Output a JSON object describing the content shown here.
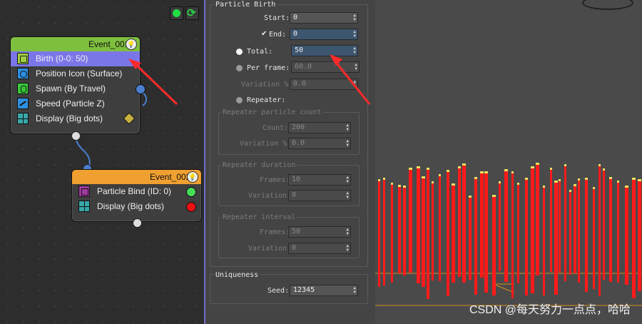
{
  "graph": {
    "toolbar": {
      "enable_icon": "green-circle-icon",
      "refresh_icon": "refresh-icon"
    },
    "event1": {
      "title": "Event_001",
      "color": "#7fbf3f",
      "operators": [
        {
          "label": "Birth (0-0: 50)",
          "icon": "birth-icon",
          "selected": true
        },
        {
          "label": "Position Icon (Surface)",
          "icon": "position-icon-icon"
        },
        {
          "label": "Spawn (By Travel)",
          "icon": "spawn-icon"
        },
        {
          "label": "Speed (Particle Z)",
          "icon": "speed-icon"
        },
        {
          "label": "Display (Big dots)",
          "icon": "display-icon"
        }
      ]
    },
    "event2": {
      "title": "Event_002",
      "color": "#f0a030",
      "operators": [
        {
          "label": "Particle Bind (ID: 0)",
          "icon": "particle-bind-icon"
        },
        {
          "label": "Display (Big dots)",
          "icon": "display-icon"
        }
      ]
    }
  },
  "panel": {
    "section_title": "Particle Birth",
    "start": {
      "label": "Start:",
      "value": "0"
    },
    "end": {
      "label": "End:",
      "value": "0",
      "checked": true
    },
    "total": {
      "label": "Total:",
      "value": "50"
    },
    "per_frame": {
      "label": "Per frame:",
      "value": "60.0"
    },
    "variation1": {
      "label": "Variation %:",
      "value": "0.0"
    },
    "repeater": {
      "label": "Repeater:"
    },
    "repeater_count": {
      "title": "Repeater particle count",
      "count": {
        "label": "Count:",
        "value": "200"
      },
      "variation": {
        "label": "Variation %:",
        "value": "0.0"
      }
    },
    "repeater_duration": {
      "title": "Repeater duration",
      "frames": {
        "label": "Frames:",
        "value": "10"
      },
      "variation": {
        "label": "Variation:",
        "value": "0"
      }
    },
    "repeater_interval": {
      "title": "Repeater interval",
      "frames": {
        "label": "Frames:",
        "value": "50"
      },
      "variation": {
        "label": "Variation:",
        "value": "0"
      }
    },
    "uniqueness": {
      "title": "Uniqueness",
      "seed": {
        "label": "Seed:",
        "value": "12345"
      }
    }
  },
  "viewport": {
    "particle_color": "#ff1a1a",
    "tip_color": "#f0e060"
  },
  "watermark": "CSDN @每天努力一点点，哈哈"
}
